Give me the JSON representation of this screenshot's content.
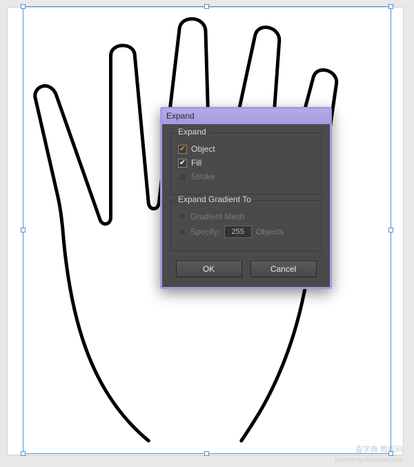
{
  "dialog": {
    "title": "Expand",
    "group_expand": {
      "label": "Expand",
      "object_label": "Object",
      "fill_label": "Fill",
      "stroke_label": "Stroke"
    },
    "group_gradient": {
      "label": "Expand Gradient To",
      "mesh_label": "Gradient Mesh",
      "specify_label": "Specify:",
      "specify_value": "255",
      "specify_unit": "Objects"
    },
    "ok_label": "OK",
    "cancel_label": "Cancel"
  },
  "watermark": {
    "main": "查字典 教程网",
    "sub": "jiaocheng.chazidian.com"
  }
}
